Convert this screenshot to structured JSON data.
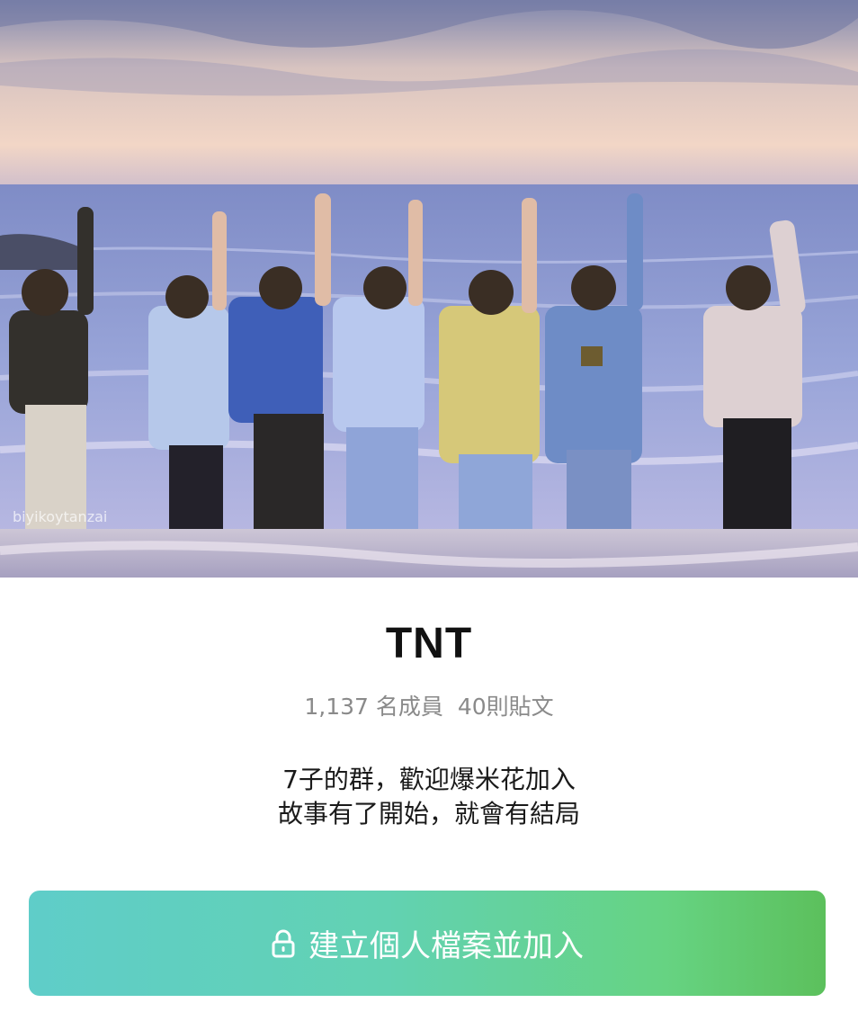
{
  "cover": {
    "watermark": "biyikoytanzai"
  },
  "group": {
    "name": "TNT",
    "members": "1,137 名成員",
    "posts": "40則貼文",
    "description_line1": "7子的群，歡迎爆米花加入",
    "description_line2": "故事有了開始，就會有結局"
  },
  "join_button": {
    "label": "建立個人檔案並加入",
    "icon": "lock-icon"
  },
  "colors": {
    "button_start": "#5fcdc9",
    "button_end": "#5cc05c"
  }
}
